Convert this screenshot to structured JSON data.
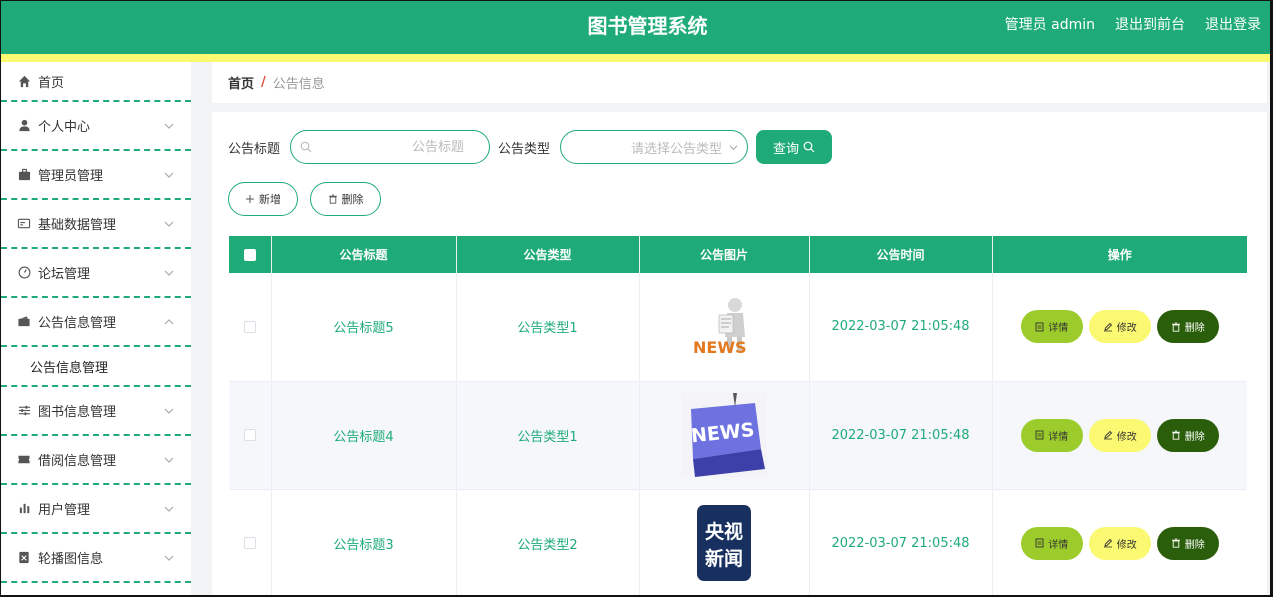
{
  "header": {
    "title": "图书管理系统",
    "user_label": "管理员 admin",
    "frontend_link": "退出到前台",
    "logout_link": "退出登录"
  },
  "sidebar": {
    "items": [
      {
        "label": "首页",
        "icon": "home-icon"
      },
      {
        "label": "个人中心",
        "icon": "user-icon"
      },
      {
        "label": "管理员管理",
        "icon": "briefcase-icon"
      },
      {
        "label": "基础数据管理",
        "icon": "card-icon"
      },
      {
        "label": "论坛管理",
        "icon": "compass-icon"
      },
      {
        "label": "公告信息管理",
        "icon": "wallet-icon",
        "expanded": true
      },
      {
        "label": "图书信息管理",
        "icon": "sliders-icon"
      },
      {
        "label": "借阅信息管理",
        "icon": "ticket-icon"
      },
      {
        "label": "用户管理",
        "icon": "bar-chart-icon"
      },
      {
        "label": "轮播图信息",
        "icon": "picture-icon"
      }
    ],
    "subitem": "公告信息管理"
  },
  "breadcrumb": {
    "home": "首页",
    "separator": "/",
    "current": "公告信息"
  },
  "search": {
    "title_label": "公告标题",
    "title_placeholder": "公告标题",
    "type_label": "公告类型",
    "type_placeholder": "请选择公告类型",
    "query_button": "查询"
  },
  "actions": {
    "add_button": "新增",
    "delete_button": "删除"
  },
  "table": {
    "columns": [
      "公告标题",
      "公告类型",
      "公告图片",
      "公告时间",
      "操作"
    ],
    "rows": [
      {
        "title": "公告标题5",
        "type": "公告类型1",
        "image": "news-3d-man",
        "time": "2022-03-07 21:05:48"
      },
      {
        "title": "公告标题4",
        "type": "公告类型1",
        "image": "news-keyboard-key",
        "time": "2022-03-07 21:05:48"
      },
      {
        "title": "公告标题3",
        "type": "公告类型2",
        "image": "cctv-news-logo",
        "time": "2022-03-07 21:05:48"
      }
    ],
    "row_actions": {
      "detail": "详情",
      "edit": "修改",
      "delete": "删除"
    },
    "image_text": {
      "news": "NEWS",
      "cctv_top": "央视",
      "cctv_bottom": "新闻"
    }
  },
  "colors": {
    "primary": "#1fab78",
    "stripe": "#fbf972",
    "detail_button": "#9ccc2b",
    "edit_button": "#fbf972",
    "delete_button": "#2b5e0a"
  }
}
